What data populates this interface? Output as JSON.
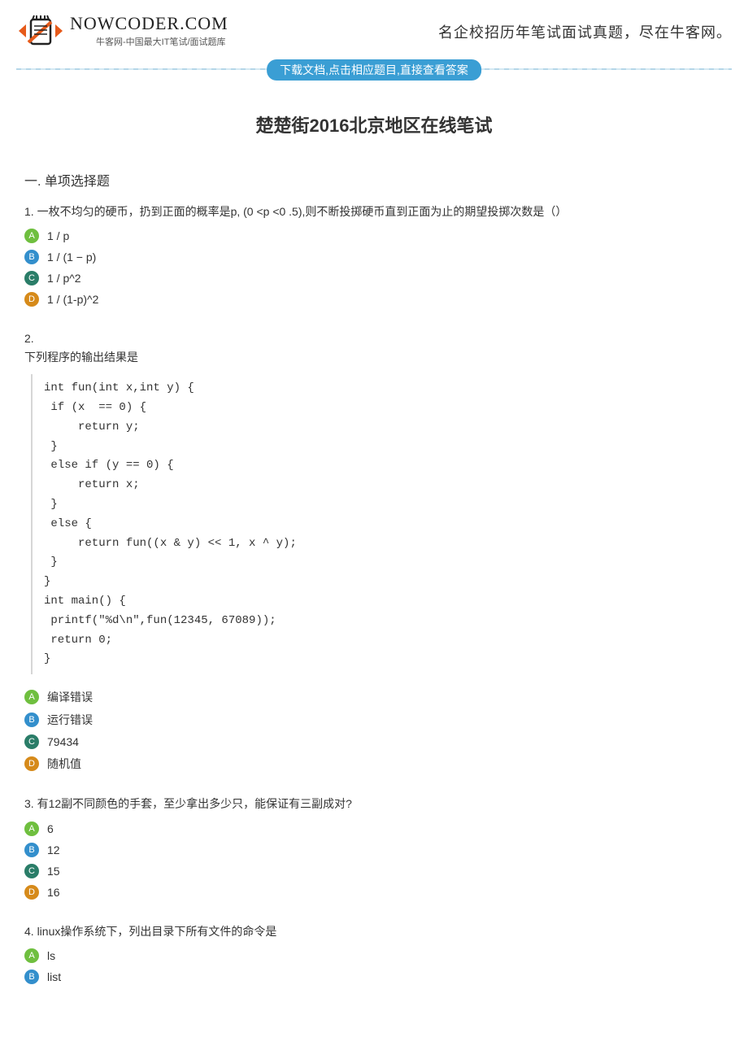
{
  "header": {
    "logo_name": "NOWCODER.COM",
    "logo_sub": "牛客网-中国最大IT笔试/面试题库",
    "slogan": "名企校招历年笔试面试真题，尽在牛客网。",
    "banner": "下载文档,点击相应题目,直接查看答案"
  },
  "title": "楚楚街2016北京地区在线笔试",
  "section1_heading": "一. 单项选择题",
  "questions": [
    {
      "text": "1. 一枚不均匀的硬币，扔到正面的概率是p, (0 <p <0 .5),则不断投掷硬币直到正面为止的期望投掷次数是（）",
      "choices": [
        "1 / p",
        "1 / (1 − p)",
        "1 / p^2",
        "1 / (1-p)^2"
      ]
    },
    {
      "text": "2.\n下列程序的输出结果是",
      "code": "int fun(int x,int y) {\n if (x  == 0) {\n     return y;\n }\n else if (y == 0) {\n     return x;\n }\n else {\n     return fun((x & y) << 1, x ^ y);\n }\n}\nint main() {\n printf(\"%d\\n\",fun(12345, 67089));\n return 0;\n}",
      "choices": [
        "编译错误",
        "运行错误",
        "79434",
        "随机值"
      ]
    },
    {
      "text": "3. 有12副不同颜色的手套，至少拿出多少只，能保证有三副成对?",
      "choices": [
        "6",
        "12",
        "15",
        "16"
      ]
    },
    {
      "text": "4. linux操作系统下，列出目录下所有文件的命令是",
      "choices": [
        "ls",
        "list"
      ]
    }
  ],
  "badge_letters": [
    "A",
    "B",
    "C",
    "D"
  ]
}
